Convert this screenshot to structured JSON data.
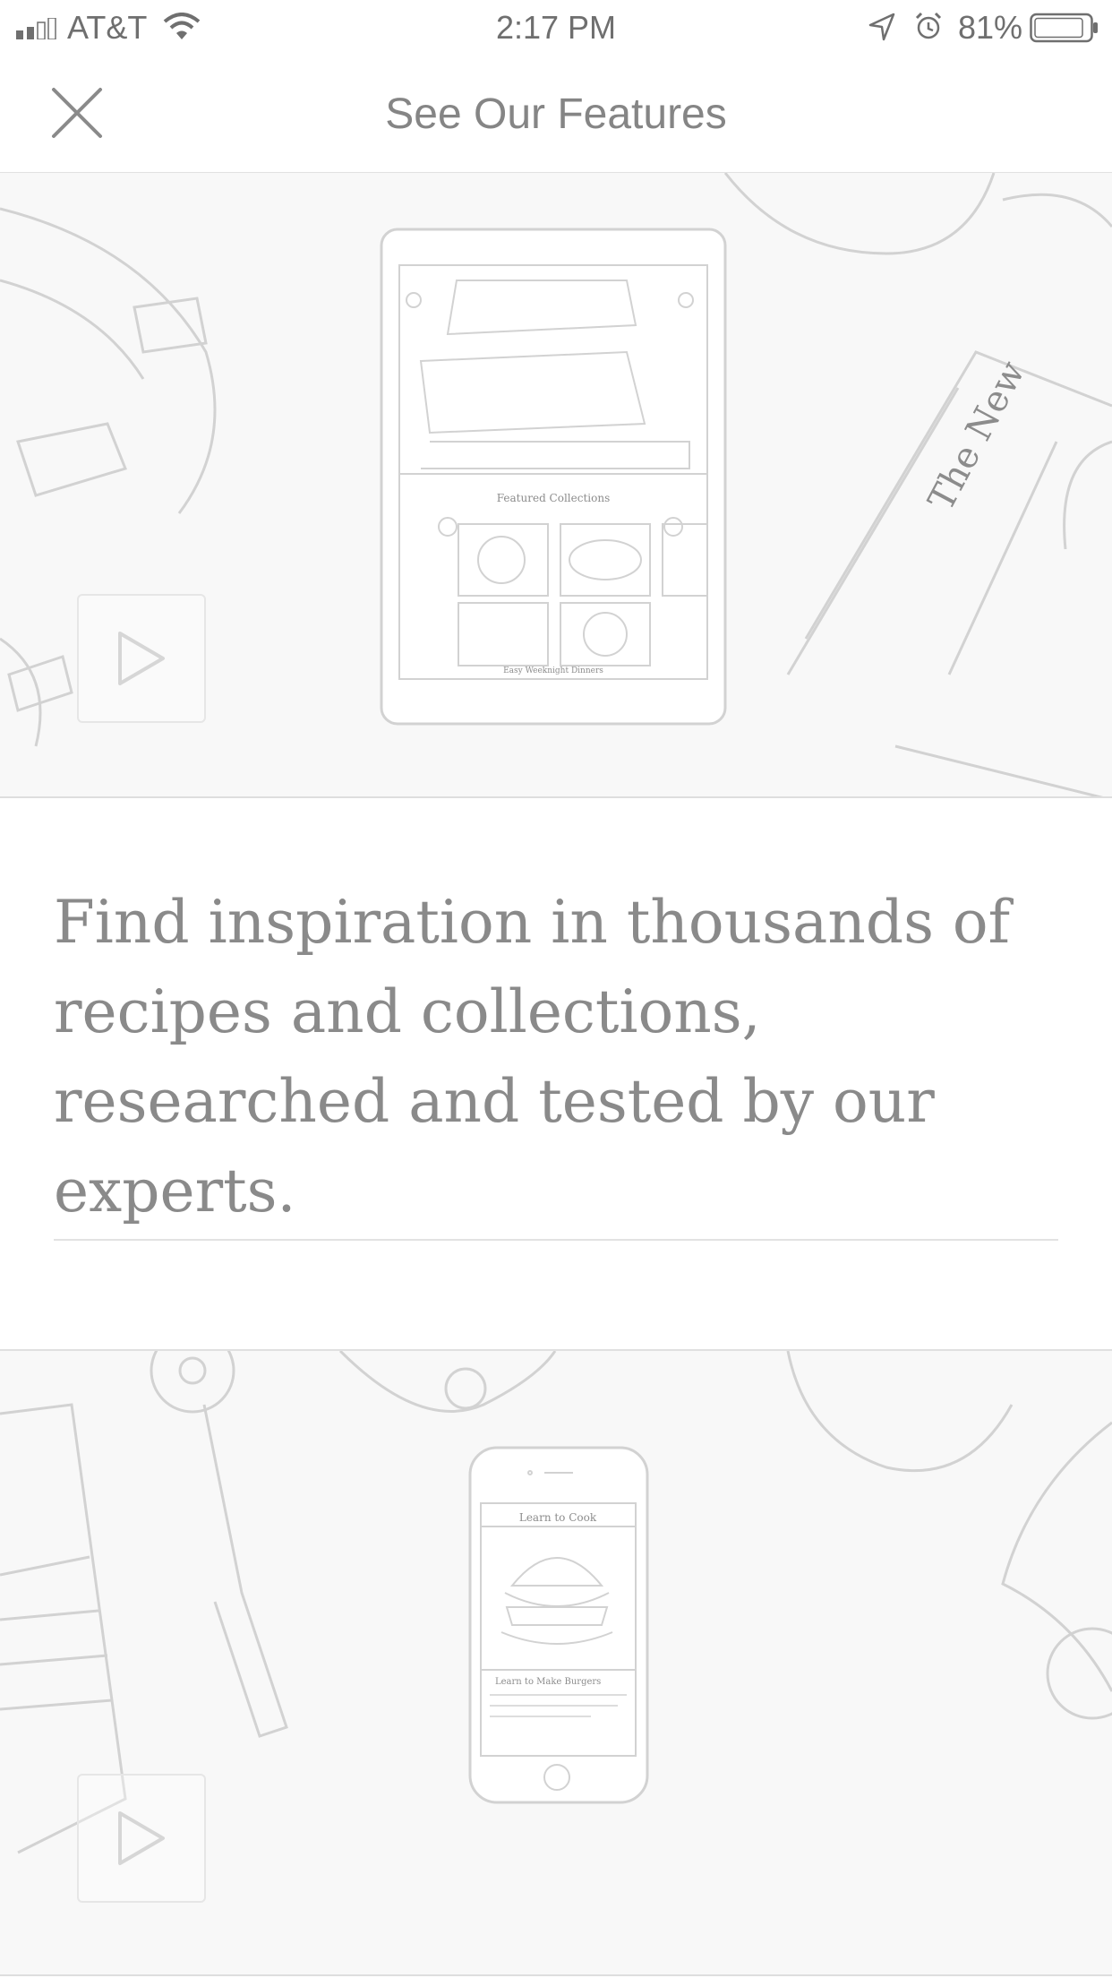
{
  "status_bar": {
    "carrier": "AT&T",
    "time": "2:17 PM",
    "battery": "81%"
  },
  "nav": {
    "title": "See Our Features"
  },
  "features": [
    {
      "device": "tablet",
      "screen_heading": "Featured Collections",
      "screen_caption": "Easy Weeknight Dinners",
      "newspaper": "The New",
      "description": "Find inspiration in thousands of recipes and collections, researched and tested by our experts."
    },
    {
      "device": "phone",
      "screen_heading": "Learn to Cook",
      "screen_caption": "Learn to Make Burgers"
    }
  ],
  "colors": {
    "text": "#8a8a8a",
    "divider": "#e2e2e2",
    "sketch": "#d2d2d2"
  }
}
